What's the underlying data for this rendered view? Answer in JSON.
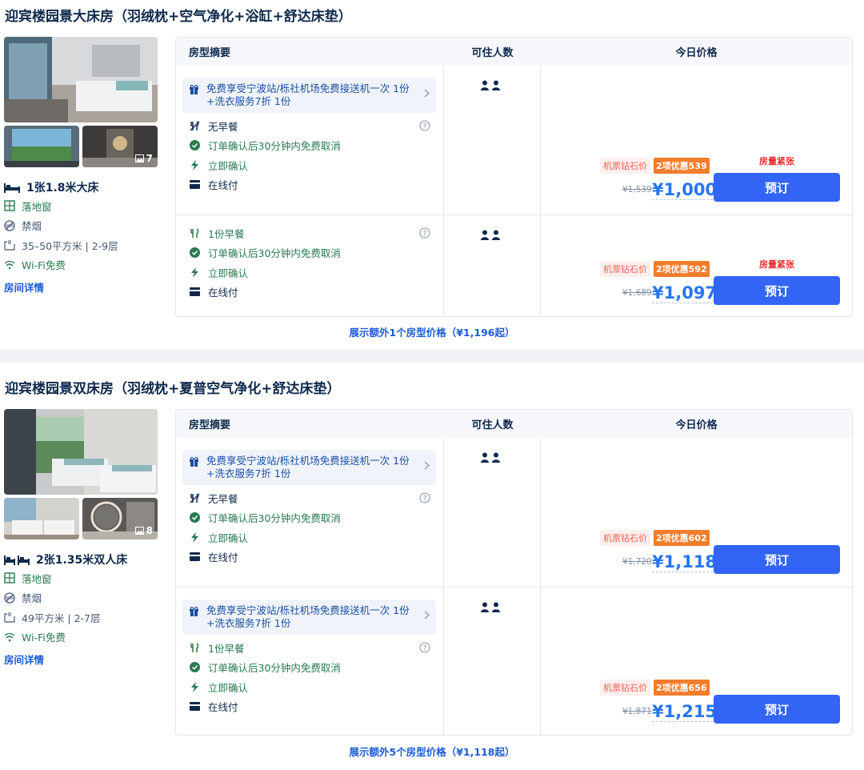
{
  "rooms": [
    {
      "title": "迎宾楼园景大床房（羽绒枕+空气净化+浴缸+舒达床垫）",
      "photo_count": "7",
      "bed": "1张1.8米大床",
      "facts": [
        "落地窗",
        "禁烟",
        "35–50平方米 | 2-9层",
        "Wi-Fi免费"
      ],
      "detail_link": "房间详情",
      "more_link": "展示额外1个房型价格（¥1,196起）",
      "offers": [
        {
          "gift": "免费享受宁波站/栎社机场免费接送机一次 1份+洗衣服务7折 1份",
          "meal": "无早餐",
          "cancel": "订单确认后30分钟内免费取消",
          "confirm": "立即确认",
          "pay": "在线付",
          "tight": "房量紧张",
          "vip": "机票钻石价",
          "promo": "2项优惠539",
          "orig": "¥1,539",
          "price": "¥1,000",
          "book": "预订"
        },
        {
          "meal": "1份早餐",
          "cancel": "订单确认后30分钟内免费取消",
          "confirm": "立即确认",
          "pay": "在线付",
          "tight": "房量紧张",
          "vip": "机票钻石价",
          "promo": "2项优惠592",
          "orig": "¥1,689",
          "price": "¥1,097",
          "book": "预订"
        }
      ]
    },
    {
      "title": "迎宾楼园景双床房（羽绒枕+夏普空气净化+舒达床垫）",
      "photo_count": "8",
      "bed": "2张1.35米双人床",
      "facts": [
        "落地窗",
        "禁烟",
        "49平方米 | 2-7层",
        "Wi-Fi免费"
      ],
      "detail_link": "房间详情",
      "more_link": "展示额外5个房型价格（¥1,118起）",
      "offers": [
        {
          "gift": "免费享受宁波站/栎社机场免费接送机一次 1份+洗衣服务7折 1份",
          "meal": "无早餐",
          "cancel": "订单确认后30分钟内免费取消",
          "confirm": "立即确认",
          "pay": "在线付",
          "vip": "机票钻石价",
          "promo": "2项优惠602",
          "orig": "¥1,720",
          "price": "¥1,118",
          "book": "预订"
        },
        {
          "gift": "免费享受宁波站/栎社机场免费接送机一次 1份+洗衣服务7折 1份",
          "meal": "1份早餐",
          "cancel": "订单确认后30分钟内免费取消",
          "confirm": "立即确认",
          "pay": "在线付",
          "vip": "机票钻石价",
          "promo": "2项优惠656",
          "orig": "¥1,871",
          "price": "¥1,215",
          "book": "预订"
        }
      ]
    }
  ],
  "table_headers": {
    "summary": "房型摘要",
    "guests": "可住人数",
    "price": "今日价格"
  },
  "colors": {
    "primary_button": "#3264f5",
    "price": "#2677ef",
    "promo": "#f27d2c",
    "green": "#287a4f",
    "warning": "#e5312c"
  }
}
